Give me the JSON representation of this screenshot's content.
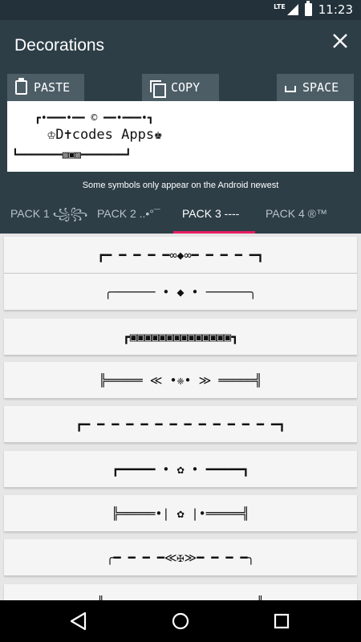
{
  "status": {
    "network": "LTE",
    "time": "11:23"
  },
  "appbar": {
    "title": "Decorations"
  },
  "toolbar": {
    "paste": "PASTE",
    "copy": "COPY",
    "space": "SPACE"
  },
  "preview": {
    "line1": "┏•━━━•━━ © ━━•━━━•┓",
    "line2": "♔D✝codes Apps♚",
    "line3": "┗━━━━━━━▧▣▨━━━━━━━┛"
  },
  "notice": "Some symbols only appear on the Android newest",
  "tabs": [
    {
      "label": "PACK 1 ꧁꧂"
    },
    {
      "label": "PACK 2 ..•°¯"
    },
    {
      "label": "PACK 3 ----"
    },
    {
      "label": "PACK 4 ®™"
    }
  ],
  "items": [
    "┏━ ━ ━ ━ ━∞◆∞━ ━ ━ ━ ━┓",
    "╭────── • ◆ • ──────╮",
    "┏▣▣▣▣▣▣▣▣▣▣▣▣▣▣┓",
    "╠═════ ≪ •❈• ≫ ═════╣",
    "┏━ ━ ━ ━ ━ ━ ━ ━ ━ ━ ━ ━ ━ ━┓",
    "┏━━━━━ • ✿ • ━━━━━┓",
    "╠═════•| ✿ |•═════╣",
    "╭━ ━ ━ ━≪✠≫━ ━ ━ ━╮",
    "║                     ║"
  ]
}
